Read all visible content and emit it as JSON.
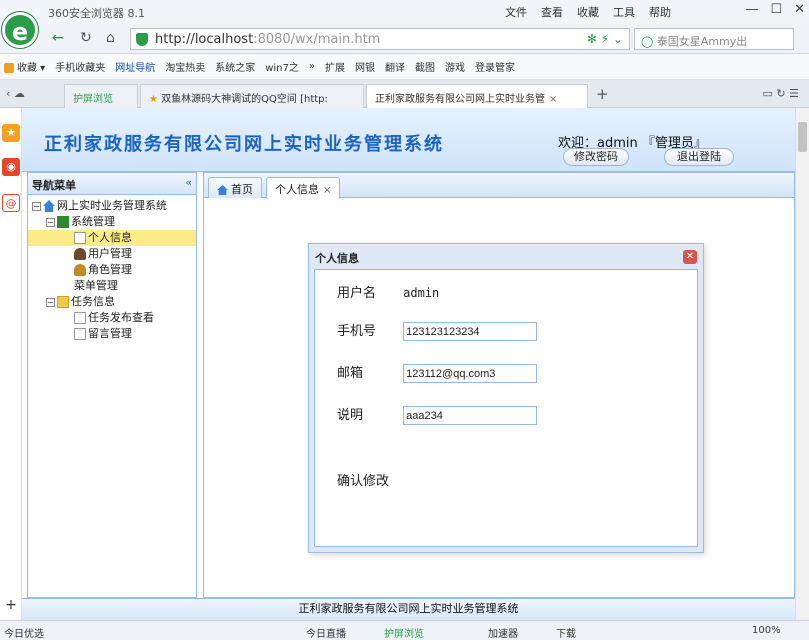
{
  "browser": {
    "title": "360安全浏览器 8.1",
    "menu": [
      "文件",
      "查看",
      "收藏",
      "工具",
      "帮助"
    ],
    "url_host": "http://localhost",
    "url_rest": ":8080/wx/main.htm",
    "search_text": "泰国女星Ammy出",
    "bookmarks": [
      "收藏",
      "手机收藏夹",
      "网址导航",
      "淘宝热卖",
      "系统之家",
      "win7之",
      "扩展",
      "网银",
      "翻译",
      "截图",
      "游戏",
      "登录管家"
    ],
    "tabs": [
      "护屏浏览",
      "双鱼林源码大神调试的QQ空间 [http:",
      "正利家政服务有限公司网上实时业务管"
    ]
  },
  "header": {
    "title": "正利家政服务有限公司网上实时业务管理系统",
    "welcome": "欢迎：admin 『管理员』",
    "change_password": "修改密码",
    "logout": "退出登陆"
  },
  "nav": {
    "title": "导航菜单",
    "collapse": "«",
    "root": "网上实时业务管理系统",
    "groups": [
      {
        "label": "系统管理",
        "items": [
          "个人信息",
          "用户管理",
          "角色管理",
          "菜单管理"
        ]
      },
      {
        "label": "任务信息",
        "items": [
          "任务发布查看",
          "留言管理"
        ]
      }
    ]
  },
  "content_tabs": {
    "home": "首页",
    "profile": "个人信息",
    "close": "×"
  },
  "dialog": {
    "title": "个人信息",
    "username_label": "用户名",
    "username_value": "admin",
    "phone_label": "手机号",
    "phone_value": "123123123234",
    "email_label": "邮箱",
    "email_value": "123112@qq.com3",
    "note_label": "说明",
    "note_value": "aaa234",
    "confirm": "确认修改"
  },
  "footer": "正利家政服务有限公司网上实时业务管理系统",
  "status": {
    "left": "今日优选",
    "items": [
      "今日直播",
      "护屏浏览",
      "加速器",
      "下载"
    ],
    "zoom": "100%"
  }
}
